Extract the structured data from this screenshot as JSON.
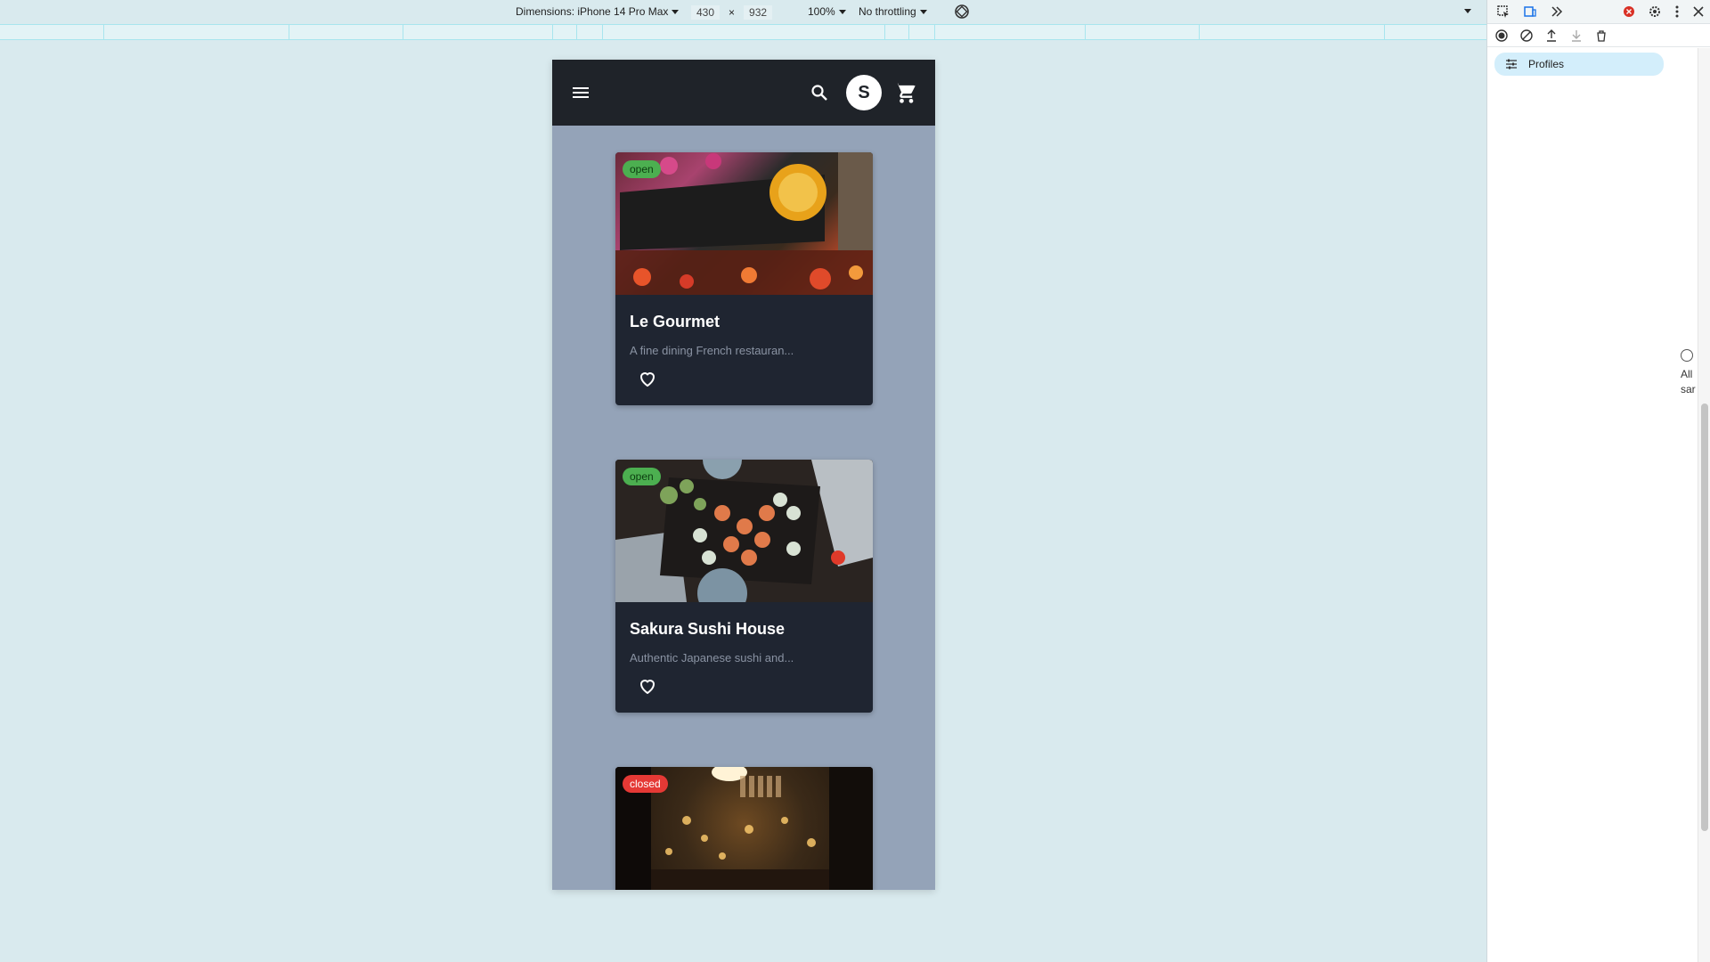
{
  "toolbar": {
    "dimensions_label": "Dimensions: iPhone 14 Pro Max",
    "width": "430",
    "times": "×",
    "height": "932",
    "zoom": "100%",
    "throttling": "No throttling"
  },
  "app": {
    "avatar_letter": "S",
    "restaurants": [
      {
        "name": "Le Gourmet",
        "description": "A fine dining French restauran...",
        "status": "open"
      },
      {
        "name": "Sakura Sushi House",
        "description": "Authentic Japanese sushi and...",
        "status": "open"
      },
      {
        "name": "",
        "description": "",
        "status": "closed"
      }
    ]
  },
  "devtools": {
    "profiles_label": "Profiles",
    "side_text_1": "All",
    "side_text_2": "sar"
  },
  "colors": {
    "open": "#4caf50",
    "closed": "#e53935",
    "appbar": "#1f2329",
    "phone_bg": "#94a3b8"
  }
}
